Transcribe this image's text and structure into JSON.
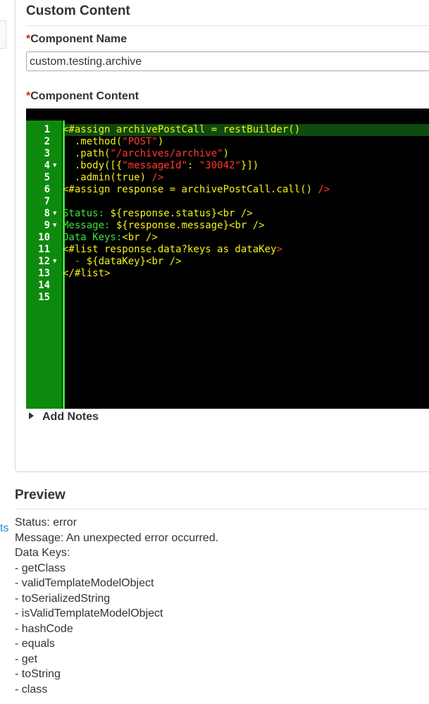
{
  "left": {
    "link_fragment": "ts"
  },
  "custom_content": {
    "title": "Custom Content",
    "name_label": "Component Name",
    "name_value": "custom.testing.archive",
    "content_label": "Component Content",
    "required_marker": "*"
  },
  "editor": {
    "lines": [
      {
        "n": "1",
        "fold": "",
        "parts": [
          {
            "t": "<#assign archivePostCall = restBuilder()",
            "c": "y"
          }
        ]
      },
      {
        "n": "2",
        "fold": "",
        "parts": [
          {
            "t": "  .method(",
            "c": "y"
          },
          {
            "t": "\"POST\"",
            "c": "r"
          },
          {
            "t": ")",
            "c": "y"
          }
        ]
      },
      {
        "n": "3",
        "fold": "",
        "parts": [
          {
            "t": "  .path(",
            "c": "y"
          },
          {
            "t": "\"/archives/archive\"",
            "c": "r"
          },
          {
            "t": ")",
            "c": "y"
          }
        ]
      },
      {
        "n": "4",
        "fold": "▼",
        "parts": [
          {
            "t": "  .body([{",
            "c": "y"
          },
          {
            "t": "\"messageId\"",
            "c": "r"
          },
          {
            "t": ": ",
            "c": "y"
          },
          {
            "t": "\"30042\"",
            "c": "r"
          },
          {
            "t": "}])",
            "c": "y"
          }
        ]
      },
      {
        "n": "5",
        "fold": "",
        "parts": [
          {
            "t": "  .admin(true) ",
            "c": "y"
          },
          {
            "t": "/>",
            "c": "r"
          }
        ]
      },
      {
        "n": "6",
        "fold": "",
        "parts": [
          {
            "t": "<#assign response = archivePostCall.call() ",
            "c": "y"
          },
          {
            "t": "/>",
            "c": "r"
          }
        ]
      },
      {
        "n": "7",
        "fold": "",
        "parts": []
      },
      {
        "n": "8",
        "fold": "▼",
        "parts": [
          {
            "t": "Status: ",
            "c": "g"
          },
          {
            "t": "${response.status}",
            "c": "y"
          },
          {
            "t": "<br />",
            "c": "y"
          }
        ]
      },
      {
        "n": "9",
        "fold": "▼",
        "parts": [
          {
            "t": "Message: ",
            "c": "g"
          },
          {
            "t": "${response.message}",
            "c": "y"
          },
          {
            "t": "<br />",
            "c": "y"
          }
        ]
      },
      {
        "n": "10",
        "fold": "",
        "parts": [
          {
            "t": "Data Keys:",
            "c": "g"
          },
          {
            "t": "<br />",
            "c": "y"
          }
        ]
      },
      {
        "n": "11",
        "fold": "",
        "parts": [
          {
            "t": "<#list response.data?keys as dataKey",
            "c": "y"
          },
          {
            "t": ">",
            "c": "r"
          }
        ]
      },
      {
        "n": "12",
        "fold": "▼",
        "parts": [
          {
            "t": "  - ",
            "c": "g"
          },
          {
            "t": "${dataKey}",
            "c": "y"
          },
          {
            "t": "<br />",
            "c": "y"
          }
        ]
      },
      {
        "n": "13",
        "fold": "",
        "parts": [
          {
            "t": "</#list>",
            "c": "y"
          }
        ]
      },
      {
        "n": "14",
        "fold": "",
        "parts": []
      },
      {
        "n": "15",
        "fold": "",
        "parts": []
      }
    ]
  },
  "notes": {
    "label": "Add Notes"
  },
  "preview": {
    "title": "Preview",
    "lines": [
      "Status: error",
      "Message: An unexpected error occurred.",
      "Data Keys:",
      "- getClass",
      "- validTemplateModelObject",
      "- toSerializedString",
      "- isValidTemplateModelObject",
      "- hashCode",
      "- equals",
      "- get",
      "- toString",
      "- class"
    ]
  }
}
